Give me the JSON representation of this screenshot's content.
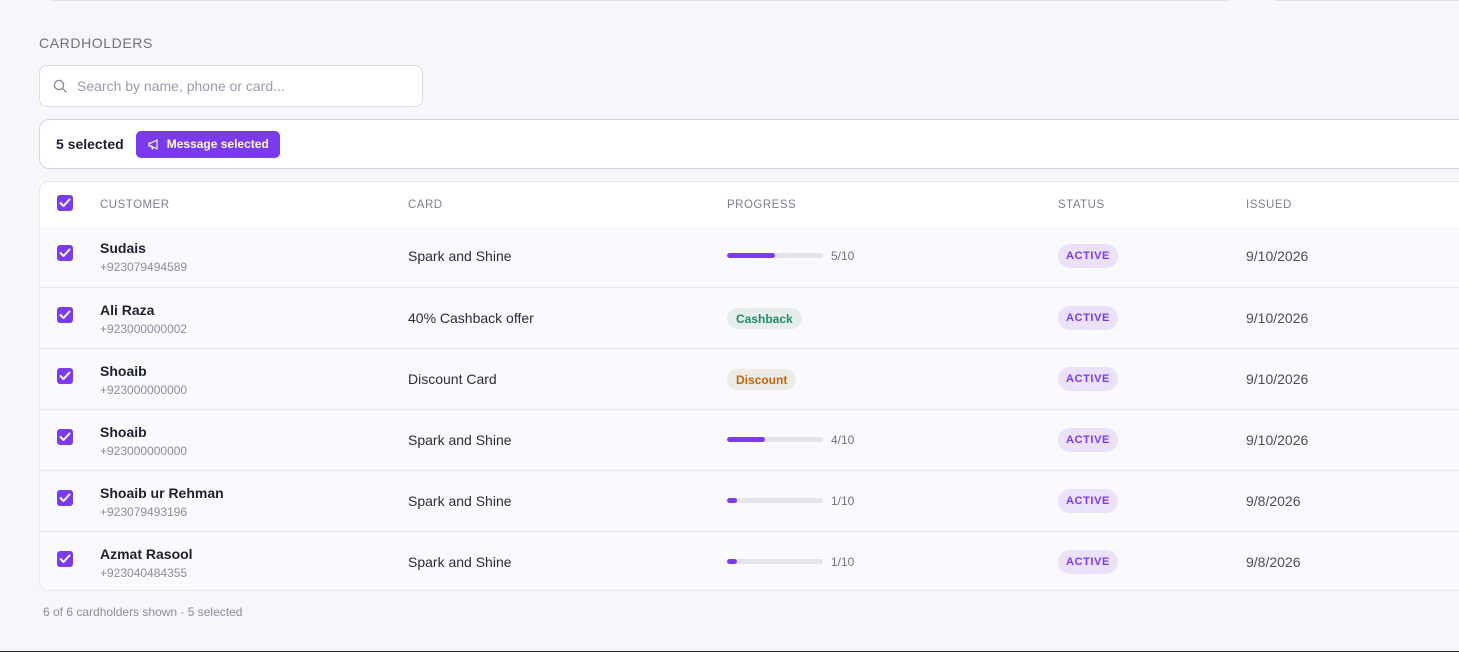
{
  "section": {
    "title": "CARDHOLDERS"
  },
  "search": {
    "placeholder": "Search by name, phone or card..."
  },
  "selection": {
    "count_label": "5 selected",
    "message_button": "Message selected"
  },
  "table": {
    "headers": {
      "customer": "CUSTOMER",
      "card": "CARD",
      "progress": "PROGRESS",
      "status": "STATUS",
      "issued": "ISSUED"
    },
    "rows": [
      {
        "name": "Sudais",
        "phone": "+923079494589",
        "card": "Spark and Shine",
        "progress_type": "stamps",
        "progress_fraction": 0.5,
        "progress_label": "5/10",
        "status": "ACTIVE",
        "issued": "9/10/2026",
        "checked": true
      },
      {
        "name": "Ali Raza",
        "phone": "+923000000002",
        "card": "40% Cashback offer",
        "progress_type": "tag",
        "tag_label": "Cashback",
        "tag_kind": "cashback",
        "status": "ACTIVE",
        "issued": "9/10/2026",
        "checked": true
      },
      {
        "name": "Shoaib",
        "phone": "+923000000000",
        "card": "Discount Card",
        "progress_type": "tag",
        "tag_label": "Discount",
        "tag_kind": "discount",
        "status": "ACTIVE",
        "issued": "9/10/2026",
        "checked": true
      },
      {
        "name": "Shoaib",
        "phone": "+923000000000",
        "card": "Spark and Shine",
        "progress_type": "stamps",
        "progress_fraction": 0.4,
        "progress_label": "4/10",
        "status": "ACTIVE",
        "issued": "9/10/2026",
        "checked": true
      },
      {
        "name": "Shoaib ur Rehman",
        "phone": "+923079493196",
        "card": "Spark and Shine",
        "progress_type": "stamps",
        "progress_fraction": 0.1,
        "progress_label": "1/10",
        "status": "ACTIVE",
        "issued": "9/8/2026",
        "checked": true
      },
      {
        "name": "Azmat Rasool",
        "phone": "+923040484355",
        "card": "Spark and Shine",
        "progress_type": "stamps",
        "progress_fraction": 0.1,
        "progress_label": "1/10",
        "status": "ACTIVE",
        "issued": "9/8/2026",
        "checked": true
      }
    ]
  },
  "footer": {
    "summary": "6 of 6 cardholders shown · 5 selected"
  },
  "colors": {
    "accent": "#7c3aed",
    "status_bg": "#ebe1fb",
    "cashback": "#1f8a6e",
    "discount": "#c2650f"
  },
  "icons": {
    "search": "search-icon",
    "megaphone": "megaphone-icon",
    "check": "check-icon"
  }
}
